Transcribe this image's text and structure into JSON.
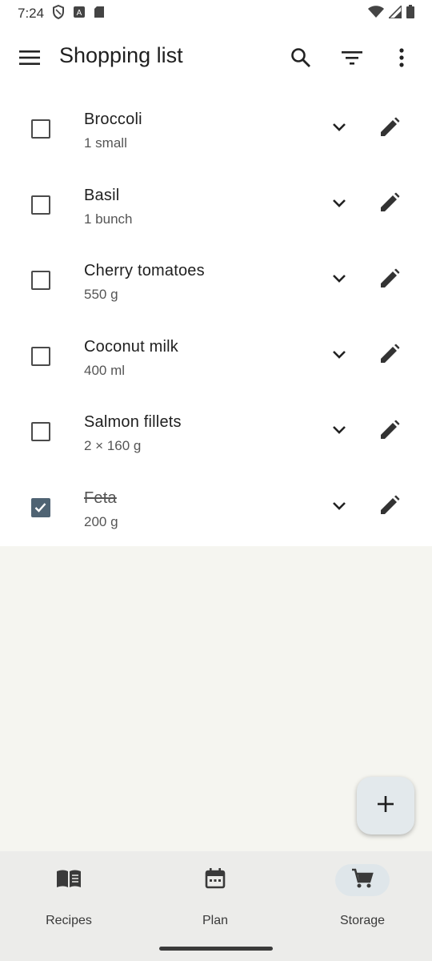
{
  "status": {
    "time": "7:24"
  },
  "appbar": {
    "title": "Shopping list"
  },
  "items": [
    {
      "name": "Broccoli",
      "qty": "1 small",
      "checked": false
    },
    {
      "name": "Basil",
      "qty": "1 bunch",
      "checked": false
    },
    {
      "name": "Cherry tomatoes",
      "qty": "550 g",
      "checked": false
    },
    {
      "name": "Coconut milk",
      "qty": "400 ml",
      "checked": false
    },
    {
      "name": "Salmon fillets",
      "qty": "2 × 160 g",
      "checked": false
    },
    {
      "name": "Feta",
      "qty": "200 g",
      "checked": true
    }
  ],
  "nav": {
    "recipes": "Recipes",
    "plan": "Plan",
    "storage": "Storage",
    "active": "storage"
  },
  "icons": {
    "menu": "menu-icon",
    "search": "search-icon",
    "filter": "filter-icon",
    "more": "more-vert-icon",
    "expand": "chevron-down-icon",
    "edit": "pencil-icon",
    "add": "plus-icon",
    "recipes": "book-icon",
    "plan": "calendar-icon",
    "storage": "cart-icon"
  },
  "colors": {
    "checked": "#4f6373",
    "accent_pill": "#dfe6ea",
    "fab": "#e3e9ec"
  }
}
